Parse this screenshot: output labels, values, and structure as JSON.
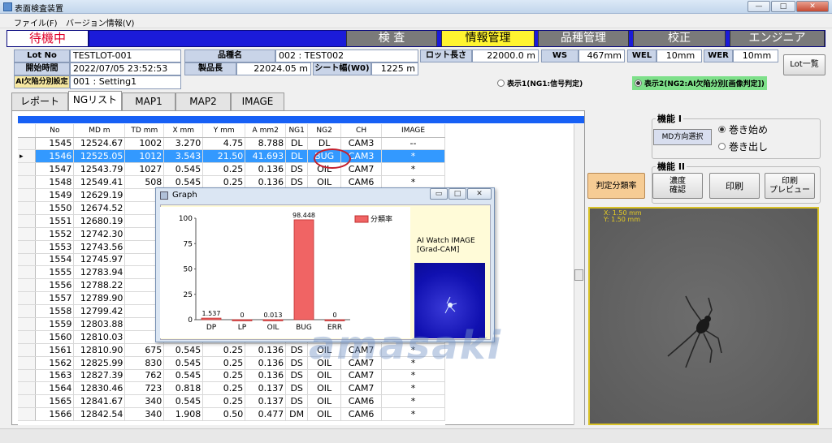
{
  "window": {
    "title": "表面検査装置",
    "buttons": [
      "—",
      "□",
      "✕"
    ]
  },
  "menu": [
    "ファイル(F)",
    "バージョン情報(V)"
  ],
  "status": "待機中",
  "nav": [
    {
      "label": "検 査"
    },
    {
      "label": "情報管理"
    },
    {
      "label": "品種管理"
    },
    {
      "label": "校正"
    },
    {
      "label": "エンジニア"
    }
  ],
  "info": {
    "lot_no_label": "Lot No",
    "lot_no": "TESTLOT-001",
    "start_label": "開始時間",
    "start": "2022/07/05 23:52:53",
    "ai_label": "AI欠陥分別設定",
    "ai": "001 : Setting1",
    "kind_label": "品種名",
    "kind": "002 : TEST002",
    "length_label": "製品長",
    "length": "22024.05 m",
    "sheet_label": "シート幅(W0)",
    "sheet": "1225 m",
    "lot_len_label": "ロット長さ",
    "lot_len": "22000.0 m",
    "ws_label": "WS",
    "ws": "467mm",
    "wel_label": "WEL",
    "wel": "10mm",
    "wer_label": "WER",
    "wer": "10mm",
    "lot_list_btn": "Lot一覧"
  },
  "display": {
    "opt1": "表示1(NG1:信号判定)",
    "opt2": "表示2(NG2:AI欠陥分別[画像判定])"
  },
  "tabs": [
    "レポート",
    "NGリスト",
    "MAP1",
    "MAP2",
    "IMAGE"
  ],
  "table": {
    "headers": [
      "No",
      "MD m",
      "TD mm",
      "X mm",
      "Y mm",
      "A mm2",
      "NG1",
      "NG2",
      "CH",
      "IMAGE"
    ],
    "rows": [
      [
        "1545",
        "12524.67",
        "1002",
        "3.270",
        "4.75",
        "8.788",
        "DL",
        "DL",
        "CAM3",
        "--"
      ],
      [
        "1546",
        "12525.05",
        "1012",
        "3.543",
        "21.50",
        "41.693",
        "DL",
        "BUG",
        "CAM3",
        "*"
      ],
      [
        "1547",
        "12543.79",
        "1027",
        "0.545",
        "0.25",
        "0.136",
        "DS",
        "OIL",
        "CAM7",
        "*"
      ],
      [
        "1548",
        "12549.41",
        "508",
        "0.545",
        "0.25",
        "0.136",
        "DS",
        "OIL",
        "CAM6",
        "*"
      ],
      [
        "1549",
        "12629.19",
        "",
        "",
        "",
        "",
        "",
        "",
        "",
        "*"
      ],
      [
        "1550",
        "12674.52",
        "",
        "",
        "",
        "",
        "",
        "",
        "",
        "*"
      ],
      [
        "1551",
        "12680.19",
        "",
        "",
        "",
        "",
        "",
        "",
        "",
        "*"
      ],
      [
        "1552",
        "12742.30",
        "",
        "",
        "",
        "",
        "",
        "",
        "",
        "*"
      ],
      [
        "1553",
        "12743.56",
        "",
        "",
        "",
        "",
        "",
        "",
        "",
        "*"
      ],
      [
        "1554",
        "12745.97",
        "",
        "",
        "",
        "",
        "",
        "",
        "",
        "*"
      ],
      [
        "1555",
        "12783.94",
        "",
        "",
        "",
        "",
        "",
        "",
        "",
        "*"
      ],
      [
        "1556",
        "12788.22",
        "",
        "",
        "",
        "",
        "",
        "",
        "",
        "*"
      ],
      [
        "1557",
        "12789.90",
        "",
        "",
        "",
        "",
        "",
        "",
        "",
        "*"
      ],
      [
        "1558",
        "12799.42",
        "",
        "",
        "",
        "",
        "",
        "",
        "",
        "*"
      ],
      [
        "1559",
        "12803.88",
        "",
        "",
        "",
        "",
        "",
        "",
        "",
        "*"
      ],
      [
        "1560",
        "12810.03",
        "",
        "",
        "",
        "",
        "",
        "",
        "",
        "*"
      ],
      [
        "1561",
        "12810.90",
        "675",
        "0.545",
        "0.25",
        "0.136",
        "DS",
        "OIL",
        "CAM7",
        "*"
      ],
      [
        "1562",
        "12825.99",
        "830",
        "0.545",
        "0.25",
        "0.136",
        "DS",
        "OIL",
        "CAM7",
        "*"
      ],
      [
        "1563",
        "12827.39",
        "762",
        "0.545",
        "0.25",
        "0.136",
        "DS",
        "OIL",
        "CAM7",
        "*"
      ],
      [
        "1564",
        "12830.46",
        "723",
        "0.818",
        "0.25",
        "0.137",
        "DS",
        "OIL",
        "CAM7",
        "*"
      ],
      [
        "1565",
        "12841.67",
        "340",
        "0.545",
        "0.25",
        "0.137",
        "DS",
        "OIL",
        "CAM6",
        "*"
      ],
      [
        "1566",
        "12842.54",
        "340",
        "1.908",
        "0.50",
        "0.477",
        "DM",
        "OIL",
        "CAM6",
        "*"
      ]
    ]
  },
  "graph_window": {
    "title": "Graph",
    "watch_label_1": "AI Watch IMAGE",
    "watch_label_2": "[Grad-CAM]"
  },
  "chart_data": {
    "type": "bar",
    "categories": [
      "DP",
      "LP",
      "OIL",
      "BUG",
      "ERR"
    ],
    "series": [
      {
        "name": "分類率",
        "values": [
          1.537,
          0,
          0.013,
          98.448,
          0
        ]
      }
    ],
    "value_labels": [
      "1.537",
      "0",
      "0.013",
      "98.448",
      "0"
    ],
    "ylim": [
      0,
      100
    ],
    "yticks": [
      "0",
      "25",
      "50",
      "75",
      "100"
    ],
    "legend": "top-right",
    "bar_color": "#f06464"
  },
  "right": {
    "func1": "機能 I",
    "md_select": "MD方向選択",
    "wind_start": "巻き始め",
    "wind_out": "巻き出し",
    "func2": "機能 II",
    "judge": "判定分類率",
    "density_1": "濃度",
    "density_2": "確認",
    "print": "印刷",
    "preview_1": "印刷",
    "preview_2": "プレビュー",
    "cam_x": "X: 1.50 mm",
    "cam_y": "Y: 1.50 mm"
  },
  "watermark": "amasaki"
}
